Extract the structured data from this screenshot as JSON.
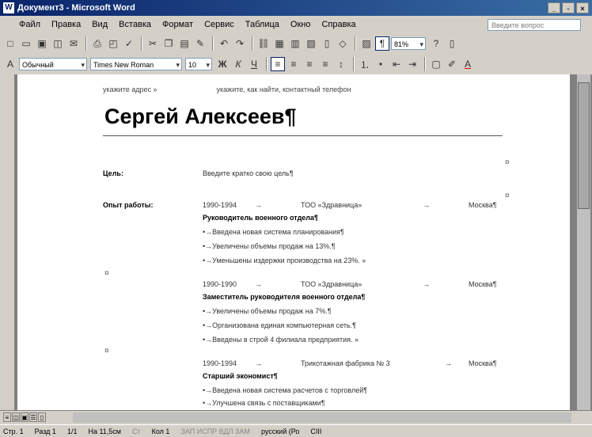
{
  "window": {
    "title": "Документ3 - Microsoft Word"
  },
  "menu": [
    "Файл",
    "Правка",
    "Вид",
    "Вставка",
    "Формат",
    "Сервис",
    "Таблица",
    "Окно",
    "Справка"
  ],
  "help": {
    "placeholder": "Введите вопрос"
  },
  "toolbar": {
    "zoom": "81%",
    "style": "Обычный",
    "font": "Times New Roman",
    "size": "10"
  },
  "document": {
    "top_line_left": "укажите адрес »",
    "top_line_right": "укажите, как найти, контактный телефон",
    "name": "Сергей Алексеев¶",
    "goal_label": "Цель:",
    "goal_text": "Введите кратко свою цель¶",
    "exp_label": "Опыт работы:",
    "jobs": [
      {
        "years": "1990-1994",
        "company": "ТОО «Здравница»",
        "city": "Москва¶",
        "title": "Руководитель военного отдела¶",
        "bullets": [
          "Введена новая система планирования¶",
          "Увеличены объемы продаж на 13%.¶",
          "Уменьшены издержки производства на 23%. »"
        ]
      },
      {
        "years": "1990-1990",
        "company": "ТОО «Здравница»",
        "city": "Москва¶",
        "title": "Заместитель руководителя военного отдела¶",
        "bullets": [
          "Увеличены объемы продаж на 7%.¶",
          "Организована единая компьютерная сеть.¶",
          "Введены в строй 4 филиала предприятия. »"
        ]
      },
      {
        "years": "1990-1994",
        "company": "Трикотажная фабрика № 3",
        "city": "Москва¶",
        "title": "Старший экономист¶",
        "bullets": [
          "Введена новая система расчетов с торговлей¶",
          "Улучшена связь с поставщиками¶"
        ]
      }
    ]
  },
  "status": {
    "page": "Стр. 1",
    "section": "Разд 1",
    "pages": "1/1",
    "position": "На 11,5см",
    "line": "Ст",
    "col": "Кол 1",
    "modes": "ЗАП ИСПР ВДЛ ЗАМ",
    "lang": "русский (Ро",
    "icon": "CIII"
  }
}
